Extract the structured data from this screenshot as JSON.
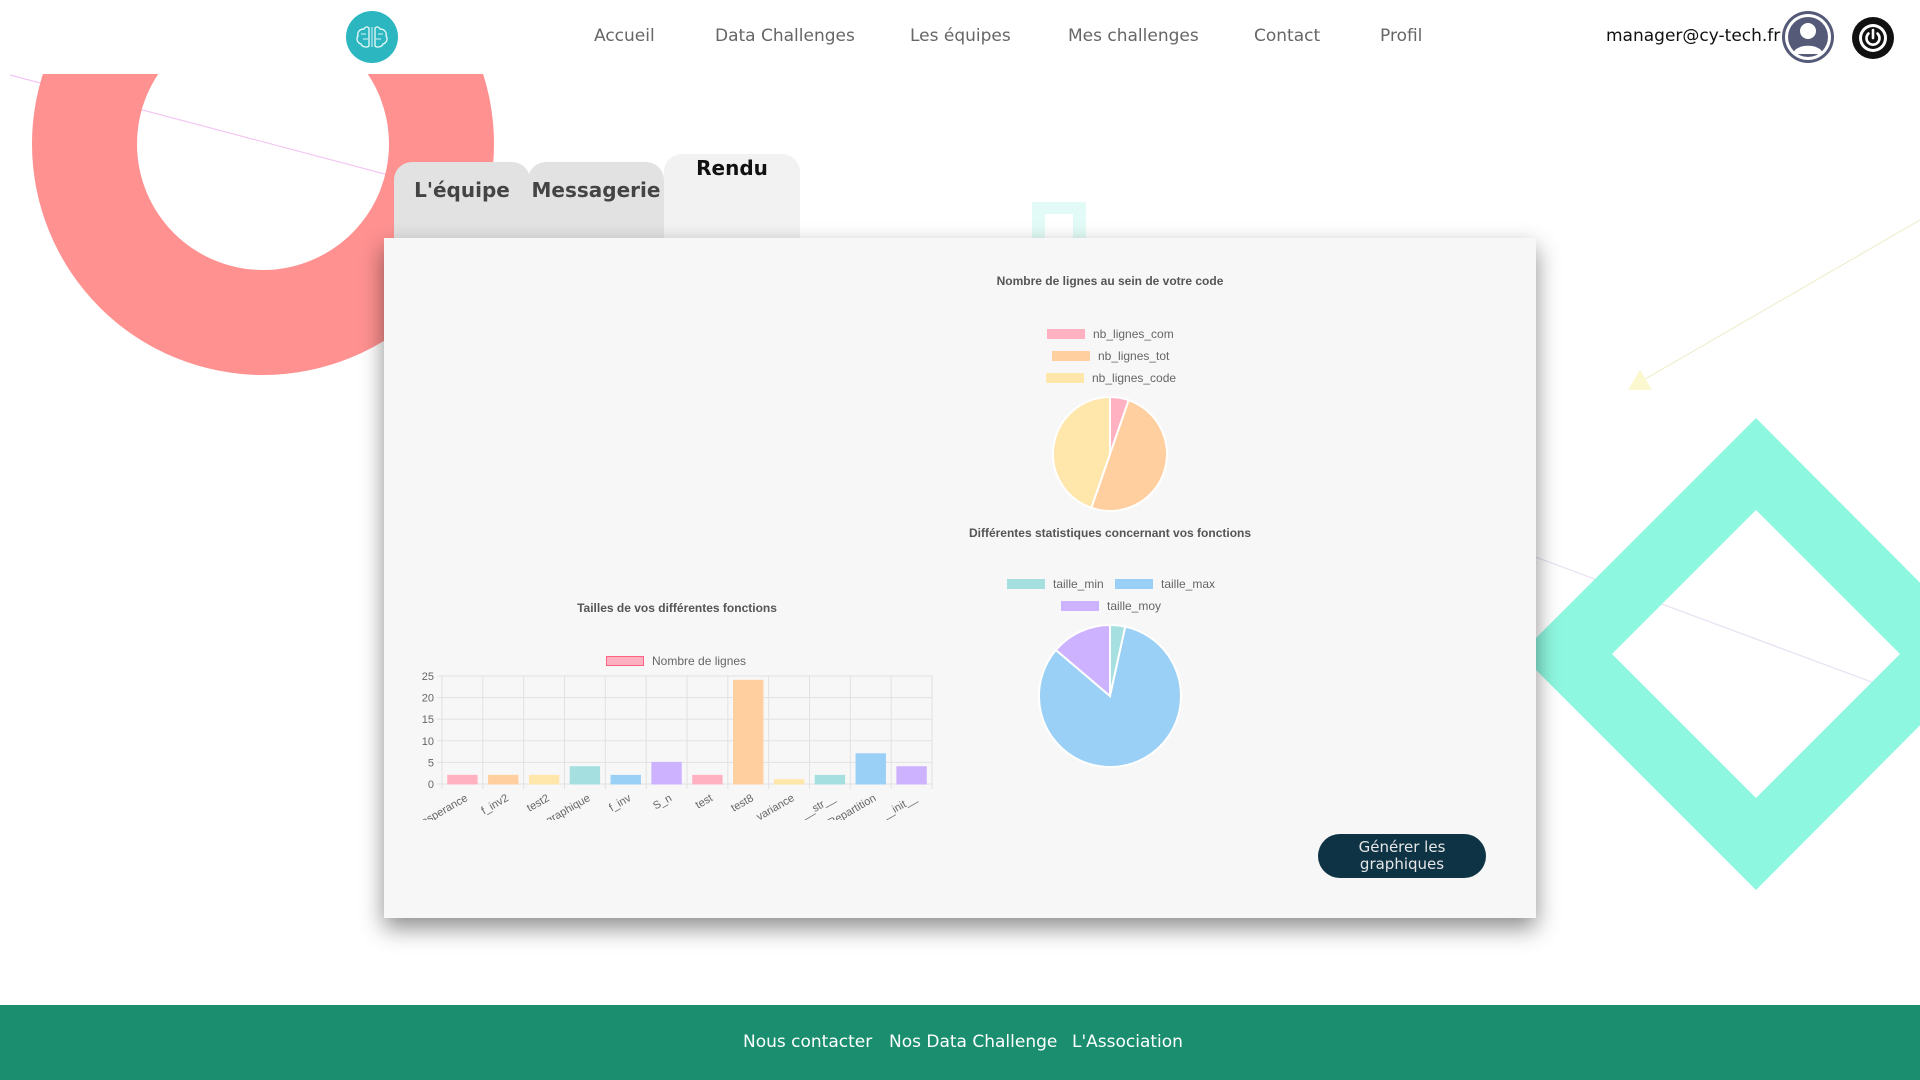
{
  "header": {
    "nav": [
      "Accueil",
      "Data Challenges",
      "Les équipes",
      "Mes challenges",
      "Contact",
      "Profil"
    ],
    "user_email": "manager@cy-tech.fr"
  },
  "tabs": [
    {
      "label": "L'équipe",
      "active": false
    },
    {
      "label": "Messagerie",
      "active": false
    },
    {
      "label": "Rendu",
      "active": true
    }
  ],
  "main": {
    "generate_button": "Générer les graphiques"
  },
  "footer": {
    "links": [
      "Nous contacter",
      "Nos Data Challenge",
      "L'Association"
    ]
  },
  "colors": {
    "teal_logo": "#2bb6c0",
    "button_dark": "#0e3345",
    "footer_green": "#1a8e6f",
    "deco_red": "#ff9191",
    "deco_mint": "#8ef7df"
  },
  "chart_data": [
    {
      "type": "pie",
      "title": "Nombre de lignes au sein de votre code",
      "legend_position": "top",
      "categories": [
        "nb_lignes_com",
        "nb_lignes_tot",
        "nb_lignes_code"
      ],
      "values": [
        5,
        47,
        42
      ],
      "colors": [
        "#ffb1c1",
        "#ffcf9f",
        "#ffe6aa"
      ]
    },
    {
      "type": "pie",
      "title": "Différentes statistiques concernant vos fonctions",
      "legend_position": "top",
      "categories": [
        "taille_min",
        "taille_max",
        "taille_moy"
      ],
      "values": [
        1,
        24,
        4
      ],
      "colors": [
        "#a5dfdf",
        "#9ad0f5",
        "#ccb2ff"
      ]
    },
    {
      "type": "bar",
      "title": "Tailles de vos différentes fonctions",
      "legend_position": "top",
      "series": [
        {
          "name": "Nombre de lignes",
          "values": [
            2,
            2,
            2,
            4,
            2,
            5,
            2,
            24,
            1,
            2,
            7,
            4
          ]
        }
      ],
      "categories": [
        "esperance",
        "f_inv2",
        "test2",
        "graphique",
        "f_inv",
        "S_n",
        "test",
        "test8",
        "variance",
        "__str__",
        "fRepartition",
        "__init__"
      ],
      "bar_colors": [
        "#ffb1c1",
        "#ffcf9f",
        "#ffe6aa",
        "#a5dfdf",
        "#9ad0f5",
        "#ccb2ff",
        "#ffb1c1",
        "#ffcf9f",
        "#ffe6aa",
        "#a5dfdf",
        "#9ad0f5",
        "#ccb2ff"
      ],
      "ylim": [
        0,
        25
      ],
      "yticks": [
        0,
        5,
        10,
        15,
        20,
        25
      ],
      "grid": true
    }
  ]
}
